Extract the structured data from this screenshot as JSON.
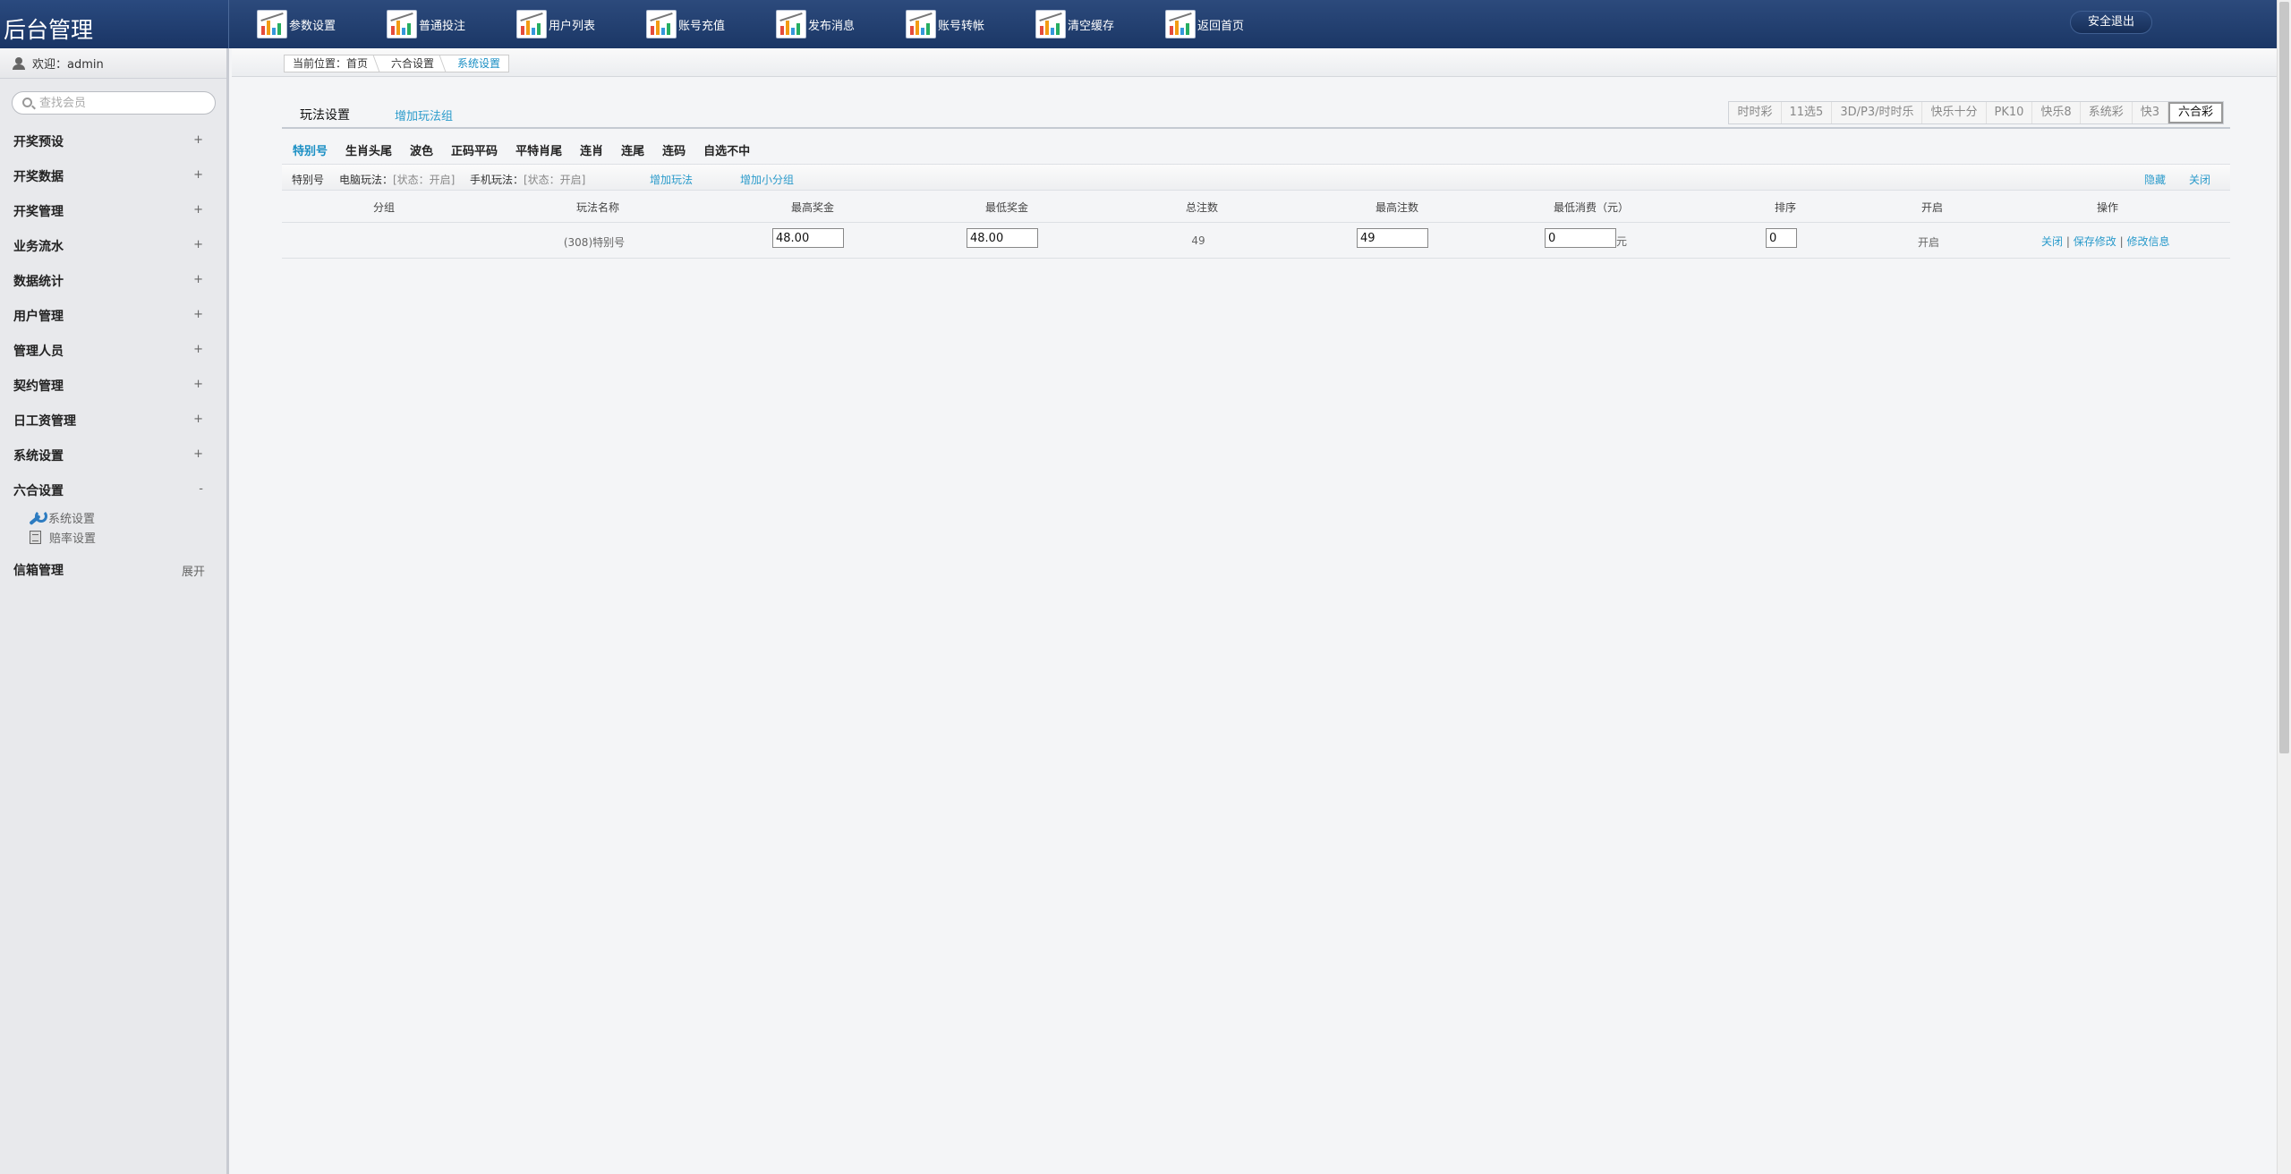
{
  "header": {
    "logo": "后台管理",
    "nav": [
      {
        "label": "参数设置",
        "name": "nav-params"
      },
      {
        "label": "普通投注",
        "name": "nav-bets"
      },
      {
        "label": "用户列表",
        "name": "nav-users"
      },
      {
        "label": "账号充值",
        "name": "nav-recharge"
      },
      {
        "label": "发布消息",
        "name": "nav-messages"
      },
      {
        "label": "账号转帐",
        "name": "nav-transfer"
      },
      {
        "label": "清空缓存",
        "name": "nav-clear-cache"
      },
      {
        "label": "返回首页",
        "name": "nav-home"
      }
    ],
    "logout": "安全退出"
  },
  "sidebar": {
    "welcome": "欢迎：admin",
    "search_placeholder": "查找会员",
    "menu": [
      {
        "label": "开奖预设",
        "toggle": "+"
      },
      {
        "label": "开奖数据",
        "toggle": "+"
      },
      {
        "label": "开奖管理",
        "toggle": "+"
      },
      {
        "label": "业务流水",
        "toggle": "+"
      },
      {
        "label": "数据统计",
        "toggle": "+"
      },
      {
        "label": "用户管理",
        "toggle": "+"
      },
      {
        "label": "管理人员",
        "toggle": "+"
      },
      {
        "label": "契约管理",
        "toggle": "+"
      },
      {
        "label": "日工资管理",
        "toggle": "+"
      },
      {
        "label": "系统设置",
        "toggle": "+"
      },
      {
        "label": "六合设置",
        "toggle": "-"
      }
    ],
    "submenu": [
      "系统设置",
      "赔率设置"
    ],
    "last": {
      "label": "信箱管理",
      "toggle": "展开"
    }
  },
  "breadcrumb": {
    "prefix": "当前位置：首页",
    "middle": "六合设置",
    "current": "系统设置"
  },
  "panel": {
    "tab_active": "玩法设置",
    "tab_add": "增加玩法组",
    "game_tabs": [
      "时时彩",
      "11选5",
      "3D/P3/时时乐",
      "快乐十分",
      "PK10",
      "快乐8",
      "系统彩",
      "快3",
      "六合彩"
    ],
    "sub_tabs": [
      "特别号",
      "生肖头尾",
      "波色",
      "正码平码",
      "平特肖尾",
      "连肖",
      "连尾",
      "连码",
      "自选不中"
    ]
  },
  "info_row": {
    "name": "特别号",
    "pc_label": "电脑玩法：",
    "pc_status": "[状态：开启]",
    "mobile_label": "手机玩法：",
    "mobile_status": "[状态：开启]",
    "add_play": "增加玩法",
    "add_subgroup": "增加小分组",
    "hide": "隐藏",
    "close": "关闭"
  },
  "table": {
    "headers": [
      "分组",
      "玩法名称",
      "最高奖金",
      "最低奖金",
      "总注数",
      "最高注数",
      "最低消费（元）",
      "排序",
      "开启",
      "操作"
    ],
    "rows": [
      {
        "name": "(308)特别号",
        "max_bonus": "48.00",
        "min_bonus": "48.00",
        "total_bets": "49",
        "max_bets": "49",
        "min_spend": "0",
        "unit": "元",
        "sort": "0",
        "enabled": "开启",
        "action_close": "关闭",
        "action_save": "保存修改",
        "action_edit": "修改信息",
        "divider": "|"
      }
    ]
  }
}
